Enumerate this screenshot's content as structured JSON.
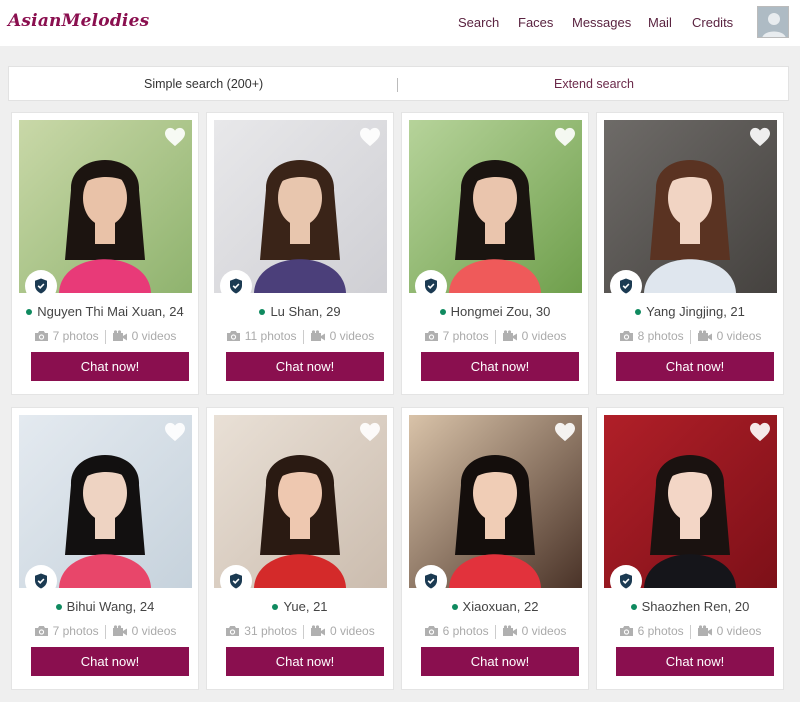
{
  "brand": {
    "logo": "AsianMelodies",
    "accent": "#8a0f4f",
    "online": "#0f8a5f"
  },
  "nav": [
    "Search",
    "Faces",
    "Messages",
    "Mail",
    "Credits"
  ],
  "search": {
    "simple": "Simple search (200+)",
    "extend": "Extend search"
  },
  "icons": {
    "favorite": "heart-icon",
    "verified": "shield-check-icon",
    "photos": "camera-icon",
    "videos": "video-camera-icon"
  },
  "profiles": [
    {
      "name": "Nguyen Thi Mai Xuan, 24",
      "photos": "7 photos",
      "videos": "0 videos",
      "chat": "Chat now!"
    },
    {
      "name": "Lu Shan, 29",
      "photos": "11 photos",
      "videos": "0 videos",
      "chat": "Chat now!"
    },
    {
      "name": "Hongmei Zou, 30",
      "photos": "7 photos",
      "videos": "0 videos",
      "chat": "Chat now!"
    },
    {
      "name": "Yang Jingjing, 21",
      "photos": "8 photos",
      "videos": "0 videos",
      "chat": "Chat now!"
    },
    {
      "name": "Bihui Wang, 24",
      "photos": "7 photos",
      "videos": "0 videos",
      "chat": "Chat now!"
    },
    {
      "name": "Yue, 21",
      "photos": "31 photos",
      "videos": "0 videos",
      "chat": "Chat now!"
    },
    {
      "name": "Xiaoxuan, 22",
      "photos": "6 photos",
      "videos": "0 videos",
      "chat": "Chat now!"
    },
    {
      "name": "Shaozhen Ren, 20",
      "photos": "6 photos",
      "videos": "0 videos",
      "chat": "Chat now!"
    }
  ]
}
